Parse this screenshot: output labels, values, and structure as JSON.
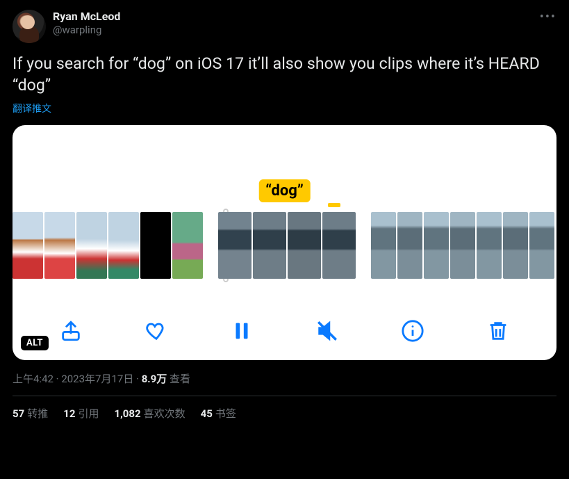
{
  "author": {
    "display_name": "Ryan McLeod",
    "handle": "@warpling"
  },
  "tweet_text": "If you search for “dog” on iOS 17 it’ll also show you clips where it’s HEARD “dog”",
  "translate_label": "翻译推文",
  "media": {
    "caption_highlight": "“dog”",
    "alt_badge": "ALT"
  },
  "meta": {
    "time": "上午4:42",
    "date": "2023年7月17日",
    "views_number": "8.9万",
    "views_label": "查看",
    "separator": " · "
  },
  "stats": {
    "retweets": {
      "count": "57",
      "label": "转推"
    },
    "quotes": {
      "count": "12",
      "label": "引用"
    },
    "likes": {
      "count": "1,082",
      "label": "喜欢次数"
    },
    "bookmarks": {
      "count": "45",
      "label": "书签"
    }
  },
  "icons": {
    "share": "share-icon",
    "heart": "heart-icon",
    "pause": "pause-icon",
    "mute": "mute-icon",
    "info": "info-icon",
    "trash": "trash-icon",
    "more": "more-icon"
  }
}
